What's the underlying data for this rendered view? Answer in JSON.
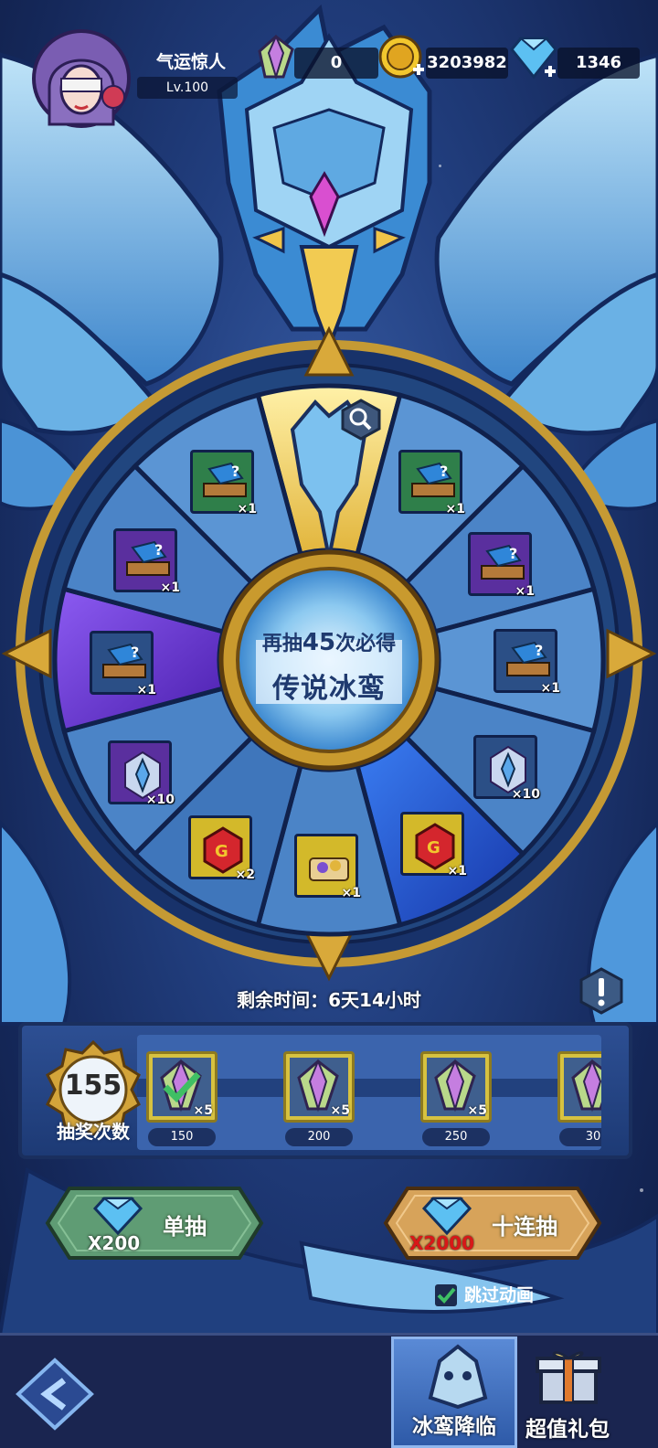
{
  "player": {
    "name": "气运惊人",
    "level": "Lv.100"
  },
  "resources": {
    "crystal": "0",
    "gold": "3203982",
    "diamond": "1346"
  },
  "wheel": {
    "center_line1_prefix": "再抽",
    "center_line1_number": "45",
    "center_line1_suffix": "次必得",
    "center_line2": "传说冰鸾",
    "rewards": [
      {
        "item": "green-chest",
        "count": "×1"
      },
      {
        "item": "green-chest",
        "count": "×1"
      },
      {
        "item": "purple-chest",
        "count": "×1"
      },
      {
        "item": "purple-chest",
        "count": "×1"
      },
      {
        "item": "blue-chest",
        "count": "×1"
      },
      {
        "item": "blue-chest",
        "count": "×1"
      },
      {
        "item": "purple-crystal-shard",
        "count": "×10"
      },
      {
        "item": "blue-crystal-shard",
        "count": "×10"
      },
      {
        "item": "red-rune",
        "count": "×2"
      },
      {
        "item": "red-rune",
        "count": "×1"
      },
      {
        "item": "gem-scroll",
        "count": "×1"
      }
    ]
  },
  "time_remaining": "剩余时间：6天14小时",
  "progress": {
    "draw_count": "155",
    "draw_label": "抽奖次数",
    "milestones": [
      {
        "qty": "×5",
        "threshold": "150",
        "claimed": true
      },
      {
        "qty": "×5",
        "threshold": "200",
        "claimed": false
      },
      {
        "qty": "×5",
        "threshold": "250",
        "claimed": false
      },
      {
        "qty": "",
        "threshold": "30",
        "claimed": false
      }
    ]
  },
  "buttons": {
    "single": {
      "label": "单抽",
      "cost": "X200"
    },
    "ten": {
      "label": "十连抽",
      "cost": "X2000"
    },
    "skip_animation": "跳过动画"
  },
  "nav": {
    "tab_active": "冰鸾降临",
    "tab_gift": "超值礼包"
  },
  "colors": {
    "single_button": "#5f9c74",
    "ten_button": "#d7a35a",
    "ten_cost": "#d81818",
    "skip_check": "#3fbf64"
  }
}
